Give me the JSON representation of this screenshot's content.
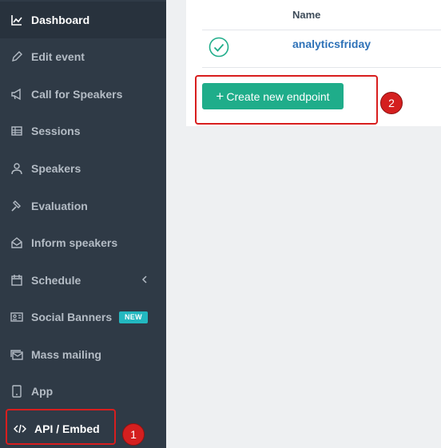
{
  "sidebar": {
    "items": [
      {
        "label": "Dashboard",
        "icon": "chart-icon"
      },
      {
        "label": "Edit event",
        "icon": "pencil-icon"
      },
      {
        "label": "Call for Speakers",
        "icon": "megaphone-icon"
      },
      {
        "label": "Sessions",
        "icon": "table-icon"
      },
      {
        "label": "Speakers",
        "icon": "user-icon"
      },
      {
        "label": "Evaluation",
        "icon": "gavel-icon"
      },
      {
        "label": "Inform speakers",
        "icon": "envelope-open-icon"
      },
      {
        "label": "Schedule",
        "icon": "calendar-icon"
      },
      {
        "label": "Social Banners",
        "icon": "id-card-icon",
        "badge": "NEW"
      },
      {
        "label": "Mass mailing",
        "icon": "mail-stack-icon"
      },
      {
        "label": "App",
        "icon": "tablet-icon"
      },
      {
        "label": "API / Embed",
        "icon": "code-icon"
      }
    ]
  },
  "table": {
    "header_name": "Name",
    "rows": [
      {
        "name": "analyticsfriday",
        "status": "check-circle-icon"
      }
    ]
  },
  "actions": {
    "create_plus": "+",
    "create_label": "Create new endpoint"
  },
  "annotations": {
    "step1": "1",
    "step2": "2"
  },
  "colors": {
    "sidebar": "#2f3a46",
    "sidebar_active": "#28323d",
    "create_button": "#1fad8a",
    "badge": "#23b8c0",
    "annotation": "#d41f1f",
    "link": "#2e72b8"
  }
}
